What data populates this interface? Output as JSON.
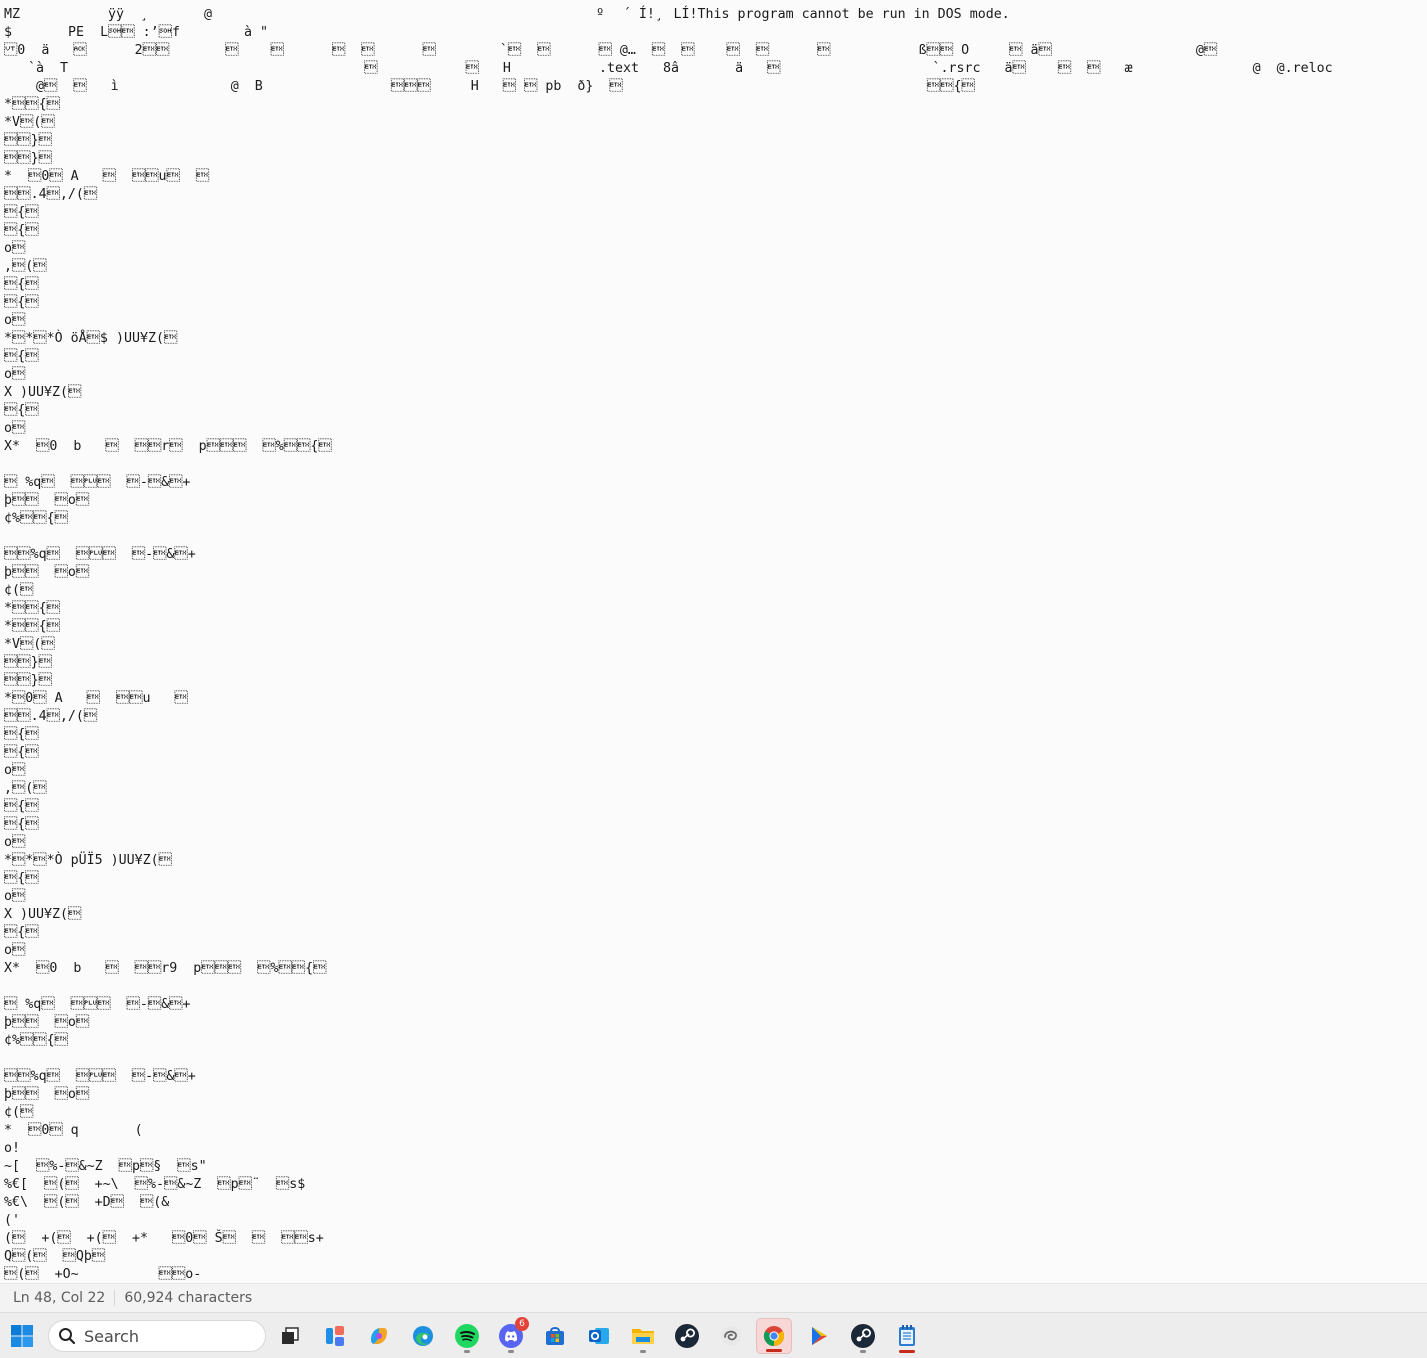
{
  "editor": {
    "text": "MZ \u0003   \u0004   ÿÿ  ¸       @                                            \u000e\u001fº\u000e ´ Í!¸\u0001LÍ!This program cannot be run in DOS mode.\n$       PE  L\u0001\u0003 :’\u0001f        à \"\n\u000b0  ä   \u0006      2\u0003\u0003       \u0003    \u0003      \u0003  \u0003      \u0003        `\u0003  \u0003      \u0003 @…  \u0003  \u0003    \u0003  \u0003      \u0003           ß\u0003\u0003 O     \u0003 ä\u0003                  @\u0003\n   `à  T                                     \u0003           \u0003   H           .text   8â       ä   \u0003                   `.rsrc   ä\u0003    \u0003  \u0003   æ               @  @.reloc\n    @\u0003  \u0003   ì              @  B                \u0003\u0003\u0003     H   \u0003 \u0003 pb  ð}  \u0003                                      \u0003\u0003{\u0003\n*\u0003\u0003{\u0003\n*V\u0003(\u0003\n\u0003\u0003}\u0003\n\u0003\u0003}\u0003\n*  \u00030\u0003 A   \u0003  \u0003\u0003u\u0003  \u0003\n\u0003\u0003.4\u0003,/(\u0003\n\u0003{\u0003\n\u0003{\u0003\no\u0003\n,\u0003(\u0003\n\u0003{\u0003\n\u0003{\u0003\no\u0003\n*\u0003*\u0003*Ò öÅ\u0003$ )UU¥Z(\u0003\n\u0003{\u0003\no\u0003\nX )UU¥Z(\u0003\n\u0003{\u0003\no\u0003\nX*  \u00030  b   \u0003  \u0003\u0003r\u0003  p\u0003\u0003\u0003  \u0003%\u0003\u0003{\u0003\n\n\u0003 %q\u0003  \u0003\u0003  \u0003-\u0003&\u0003+\nþ\u0003\u0003  \u0003o\u0003\n¢%\u0003\u0003{\u0003\n\n\u0003\u0003%q\u0003  \u0003\u0003  \u0003-\u0003&\u0003+\nþ\u0003\u0003  \u0003o\u0003\n¢(\u0003\n*\u0003\u0003{\u0003\n*\u0003\u0003{\u0003\n*V\u0003(\u0003\n\u0003\u0003}\u0003\n\u0003\u0003}\u0003\n*\u00030\u0003 A   \u0003  \u0003\u0003u   \u0003\n\u0003\u0003.4\u0003,/(\u0003\n\u0003{\u0003\n\u0003{\u0003\no\u0003\n,\u0003(\u0003\n\u0003{\u0003\n\u0003{\u0003\no\u0003\n*\u0003*\u0003*Ò pÜÏ5 )UU¥Z(\u0003\n\u0003{\u0003\no\u0003\nX )UU¥Z(\u0003\n\u0003{\u0003\no\u0003\nX*  \u00030  b   \u0003  \u0003\u0003r9  p\u0003\u0003\u0003  \u0003%\u0003\u0003{\u0003\n\n\u0003 %q\u0003  \u0003\u0003  \u0003-\u0003&\u0003+\nþ\u0003\u0003  \u0003o\u0003\n¢%\u0003\u0003{\u0003\n\n\u0003\u0003%q\u0003  \u0003\u0003  \u0003-\u0003&\u0003+\nþ\u0003\u0003  \u0003o\u0003\n¢(\u0003\n*  \u00030\u0003 q       (\no!\n~[  \u0003%-\u0003&~Z  \u0003p\u0003§  \u0003s\"\n%€[  \u0003(\u0003  +~\\  \u0003%-\u0003&~Z  \u0003p\u0003¨  \u0003s$\n%€\\  \u0003(\u0003  +D\u0003  \u0003(&\n('\n(\u0003  +(\u0003  +(\u0003  +*   \u00030\u0003 Š\u0003  \u0003  \u0003\u0003s+\nQ\u0003(\u0003  \u0003Qþ\u0003\n\u0003(\u0003  +O~          \u0003\u0003o-"
  },
  "statusbar": {
    "position": "Ln 48, Col 22",
    "characters": "60,924 characters"
  },
  "taskbar": {
    "search_label": "Search",
    "discord_badge": "6",
    "accent": "#c42b1c"
  }
}
